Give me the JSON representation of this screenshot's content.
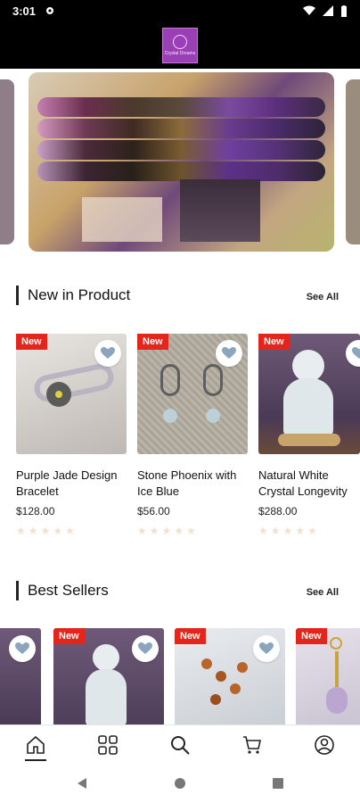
{
  "status_bar": {
    "time": "3:01"
  },
  "app_bar": {
    "logo_text": "Crystal Dreams"
  },
  "sections": {
    "new_in_product": {
      "title": "New in Product",
      "see_all": "See All",
      "products": [
        {
          "badge": "New",
          "name": "Purple Jade Design Bracelet",
          "price": "$128.00",
          "rating": 0
        },
        {
          "badge": "New",
          "name": "Stone Phoenix with Ice Blue",
          "price": "$56.00",
          "rating": 0
        },
        {
          "badge": "New",
          "name": "Natural White Crystal Longevity",
          "price": "$288.00",
          "rating": 0
        }
      ]
    },
    "best_sellers": {
      "title": "Best Sellers",
      "see_all": "See All",
      "products": [
        {
          "badge": ""
        },
        {
          "badge": "New"
        },
        {
          "badge": "New"
        },
        {
          "badge": "New"
        }
      ]
    }
  },
  "bottom_nav": {
    "items": [
      "home",
      "categories",
      "search",
      "cart",
      "account"
    ],
    "active": "home"
  },
  "colors": {
    "badge": "#e4251b",
    "star_empty": "#f2e1cf",
    "status_bar": "#000000",
    "logo_bg": "#9b3fb7"
  }
}
